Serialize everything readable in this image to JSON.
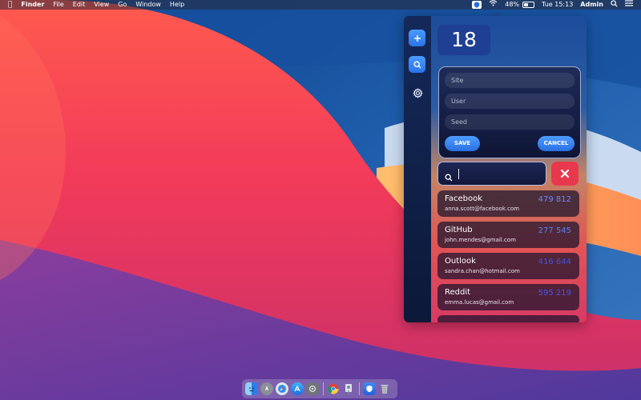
{
  "menubar": {
    "app_name": "Finder",
    "menus": [
      "File",
      "Edit",
      "View",
      "Go",
      "Window",
      "Help"
    ],
    "battery": "48%",
    "datetime": "Tue 15:13",
    "user": "Admin"
  },
  "app": {
    "count": "18",
    "form": {
      "site_placeholder": "Site",
      "user_placeholder": "User",
      "seed_placeholder": "Seed",
      "save_label": "SAVE",
      "cancel_label": "CANCEL"
    },
    "search": {
      "value": ""
    },
    "entries": [
      {
        "site": "Facebook",
        "user": "anna.scott@facebook.com",
        "code": "479 812",
        "code_color": "#6f86ff"
      },
      {
        "site": "GitHub",
        "user": "john.mendes@gmail.com",
        "code": "277 545",
        "code_color": "#5f7df7"
      },
      {
        "site": "Outlook",
        "user": "sandra.chan@hotmail.com",
        "code": "416 644",
        "code_color": "#4255e0"
      },
      {
        "site": "Reddit",
        "user": "emma.lucas@gmail.com",
        "code": "595 219",
        "code_color": "#4a56e6"
      }
    ]
  },
  "colors": {
    "accent": "#3a86f5",
    "danger": "#e8384d"
  },
  "icons": [
    "apple-icon",
    "extension-icon",
    "wifi-icon",
    "battery-icon",
    "spotlight-icon",
    "control-center-icon",
    "plus-icon",
    "search-icon",
    "gear-icon",
    "close-icon"
  ],
  "dock": [
    "finder",
    "launchpad",
    "safari",
    "app-store",
    "system-preferences",
    "chrome",
    "preview",
    "extension",
    "trash"
  ]
}
